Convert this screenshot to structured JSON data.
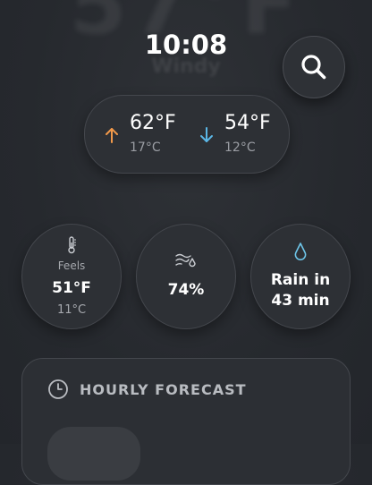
{
  "time": "10:08",
  "ghost": {
    "temperature": "57°F",
    "condition": "Windy"
  },
  "high": {
    "f": "62°F",
    "c": "17°C"
  },
  "low": {
    "f": "54°F",
    "c": "12°C"
  },
  "feels": {
    "label": "Feels",
    "f": "51°F",
    "c": "11°C"
  },
  "humidity": {
    "value": "74%"
  },
  "rain": {
    "line1": "Rain in",
    "line2": "43 min"
  },
  "forecast": {
    "title": "HOURLY FORECAST"
  },
  "colors": {
    "high_arrow": "#f2994a",
    "low_arrow": "#5bb7e6",
    "rain_drop": "#6ec6ea"
  },
  "icons": [
    "search-icon",
    "arrow-up-icon",
    "arrow-down-icon",
    "thermometer-icon",
    "humidity-icon",
    "raindrop-icon",
    "clock-icon"
  ]
}
